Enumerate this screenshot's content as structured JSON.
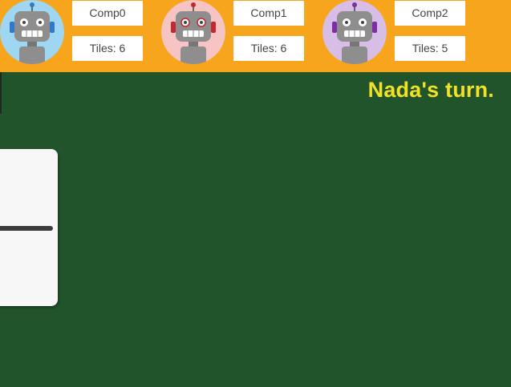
{
  "players": [
    {
      "name": "Comp0",
      "tiles_label": "Tiles: 6",
      "avatar_bg": "#9fd6f2",
      "accent": "#2f79c8",
      "icon": "robot-icon"
    },
    {
      "name": "Comp1",
      "tiles_label": "Tiles: 6",
      "avatar_bg": "#f6c4c2",
      "accent": "#c6262e",
      "icon": "robot-icon"
    },
    {
      "name": "Comp2",
      "tiles_label": "Tiles: 5",
      "avatar_bg": "#d8bde6",
      "accent": "#7b2ea6",
      "icon": "robot-icon"
    }
  ],
  "status": {
    "turn_text": "Nada's turn."
  },
  "colors": {
    "top_bar": "#f6a51d",
    "table": "#21542b",
    "turn_text": "#f2e124",
    "domino": "#f7f7f7"
  }
}
